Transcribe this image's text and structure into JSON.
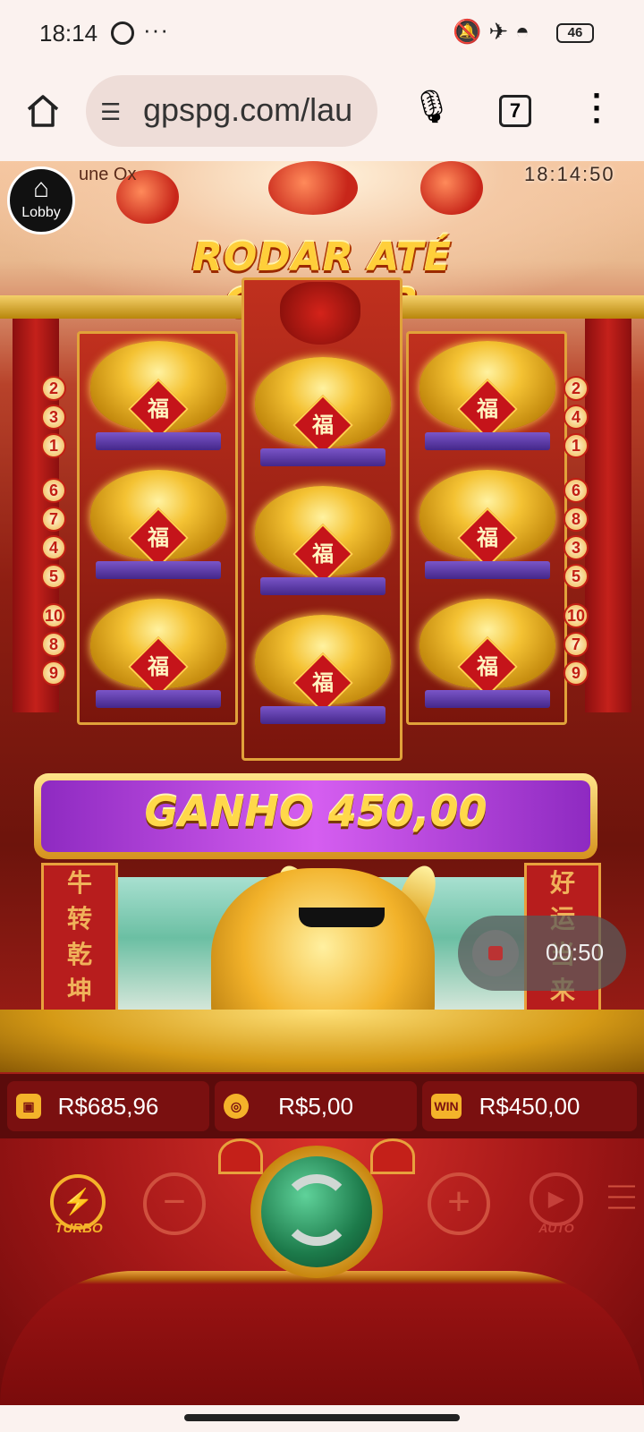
{
  "status_bar": {
    "time": "18:14",
    "notification_icons": [
      "whatsapp-icon",
      "more-dots-icon"
    ],
    "system_icons": [
      "bell-off-icon",
      "airplane-icon",
      "wifi-icon"
    ],
    "battery": "46"
  },
  "browser": {
    "url": "gpspg.com/lau",
    "tab_count": "7"
  },
  "game": {
    "title_partial": "une Ox",
    "clock": "18:14:50",
    "lobby_label": "Lobby",
    "banner": "RODAR ATÉ GANHAR",
    "symbol_char": "福",
    "paylines_left": [
      "2",
      "3",
      "1",
      "6",
      "7",
      "4",
      "5",
      "10",
      "8",
      "9"
    ],
    "paylines_right": [
      "2",
      "4",
      "1",
      "6",
      "8",
      "3",
      "5",
      "10",
      "7",
      "9"
    ],
    "win": {
      "label": "GANHO",
      "amount": "450,00"
    },
    "left_banner_chars": [
      "牛",
      "转",
      "乾",
      "坤"
    ],
    "right_banner_chars": [
      "好",
      "运",
      "当",
      "来"
    ],
    "recording_timer": "00:50",
    "balance": "R$685,96",
    "bet": "R$5,00",
    "win_amount": "R$450,00",
    "win_icon_text": "WIN",
    "turbo_label": "TURBO",
    "auto_label": "AUTO"
  }
}
